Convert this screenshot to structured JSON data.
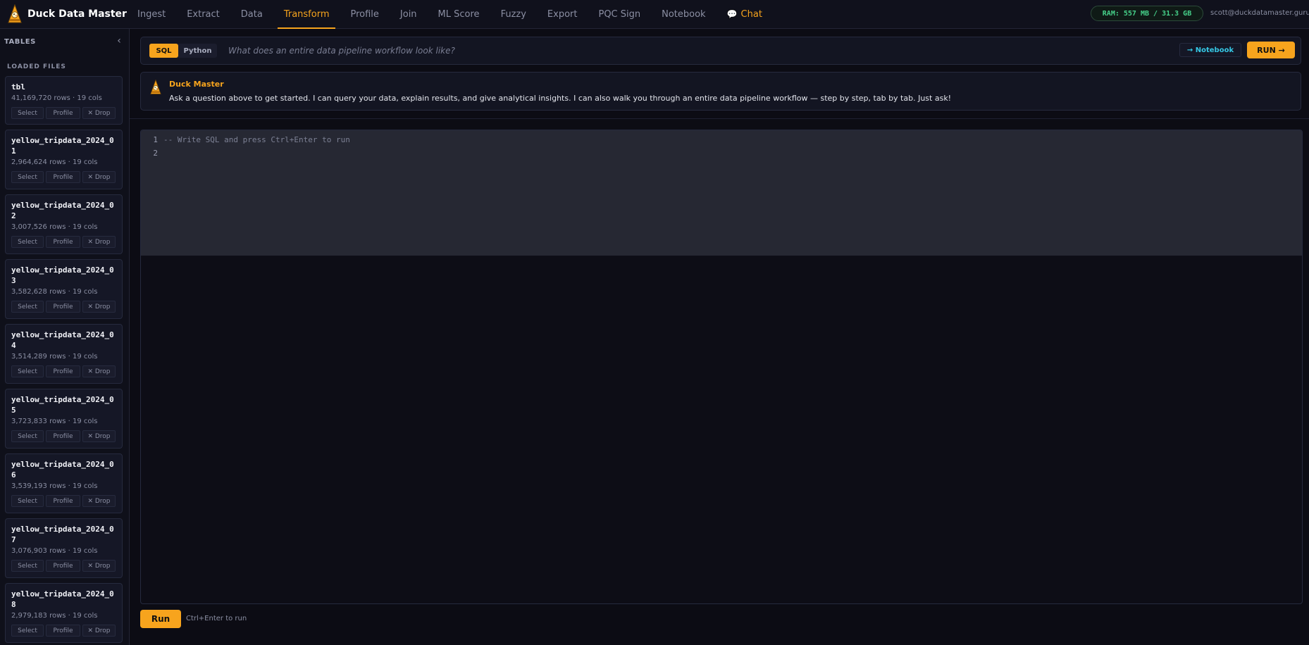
{
  "app": {
    "title": "Duck Data Master",
    "logo_icon": "duck-logo-icon"
  },
  "nav": {
    "items": [
      {
        "label": "Ingest"
      },
      {
        "label": "Extract"
      },
      {
        "label": "Data"
      },
      {
        "label": "Transform",
        "active": true
      },
      {
        "label": "Profile"
      },
      {
        "label": "Join"
      },
      {
        "label": "ML Score"
      },
      {
        "label": "Fuzzy"
      },
      {
        "label": "Export"
      },
      {
        "label": "PQC Sign"
      },
      {
        "label": "Notebook"
      }
    ],
    "chat_label": "Chat",
    "chat_icon_glyph": "💬"
  },
  "status": {
    "ram": "RAM: 557 MB / 31.3 GB",
    "user_email": "scott@duckdatamaster.guru"
  },
  "sidebar": {
    "title": "TABLES",
    "collapse_glyph": "‹",
    "section_label": "LOADED FILES",
    "action_labels": {
      "select": "Select",
      "profile": "Profile",
      "drop": "✕ Drop"
    },
    "files": [
      {
        "name": "tbl",
        "meta": "41,169,720 rows · 19 cols"
      },
      {
        "name": "yellow_tripdata_2024_01",
        "meta": "2,964,624 rows · 19 cols"
      },
      {
        "name": "yellow_tripdata_2024_02",
        "meta": "3,007,526 rows · 19 cols"
      },
      {
        "name": "yellow_tripdata_2024_03",
        "meta": "3,582,628 rows · 19 cols"
      },
      {
        "name": "yellow_tripdata_2024_04",
        "meta": "3,514,289 rows · 19 cols"
      },
      {
        "name": "yellow_tripdata_2024_05",
        "meta": "3,723,833 rows · 19 cols"
      },
      {
        "name": "yellow_tripdata_2024_06",
        "meta": "3,539,193 rows · 19 cols"
      },
      {
        "name": "yellow_tripdata_2024_07",
        "meta": "3,076,903 rows · 19 cols"
      },
      {
        "name": "yellow_tripdata_2024_08",
        "meta": "2,979,183 rows · 19 cols"
      }
    ]
  },
  "query_bar": {
    "mode_sql": "SQL",
    "mode_python": "Python",
    "placeholder": "What does an entire data pipeline workflow look like?",
    "notebook_label": "→ Notebook",
    "run_label": "RUN →"
  },
  "assistant": {
    "name": "Duck Master",
    "message": "Ask a question above to get started. I can query your data, explain results, and give analytical insights. I can also walk you through an entire data pipeline workflow — step by step, tab by tab. Just ask!"
  },
  "editor": {
    "lines": [
      {
        "no": "1",
        "text": "-- Write SQL and press Ctrl+Enter to run"
      },
      {
        "no": "2",
        "text": ""
      }
    ]
  },
  "footer": {
    "run_label": "Run",
    "hint": "Ctrl+Enter to run"
  },
  "colors": {
    "accent": "#f7a41d",
    "background": "#0c0c14",
    "ram_text": "#46d18a",
    "link": "#35c8e6"
  }
}
